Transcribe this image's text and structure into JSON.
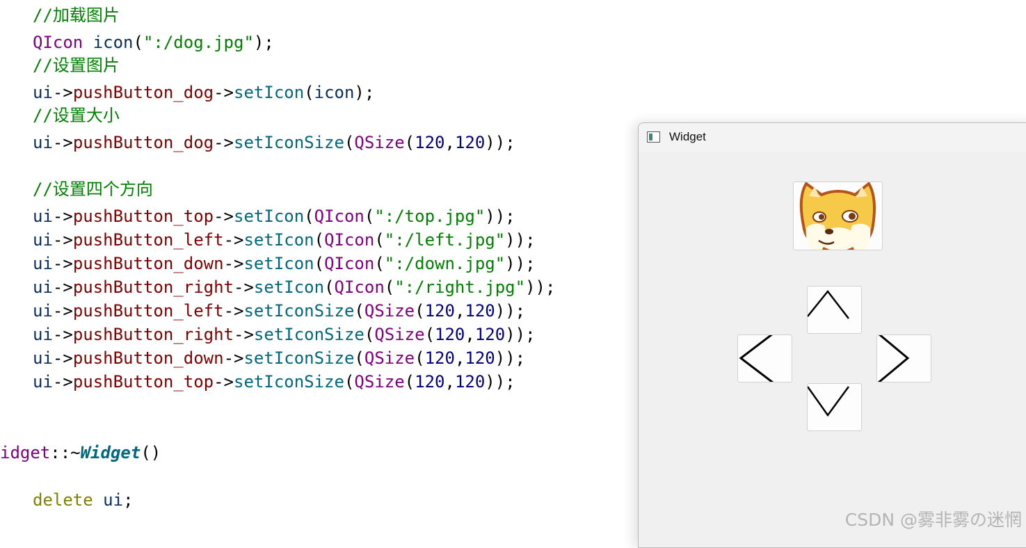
{
  "code_lines": [
    {
      "segments": [
        {
          "cls": "c",
          "text": "//加载图片"
        }
      ]
    },
    {
      "segments": [
        {
          "cls": "t",
          "text": "QIcon"
        },
        {
          "cls": "",
          "text": " "
        },
        {
          "cls": "v",
          "text": "icon"
        },
        {
          "cls": "",
          "text": "("
        },
        {
          "cls": "s",
          "text": "\":/dog.jpg\""
        },
        {
          "cls": "",
          "text": ");"
        }
      ]
    },
    {
      "segments": [
        {
          "cls": "c",
          "text": "//设置图片"
        }
      ]
    },
    {
      "segments": [
        {
          "cls": "v",
          "text": "ui"
        },
        {
          "cls": "",
          "text": "->"
        },
        {
          "cls": "m",
          "text": "pushButton_dog"
        },
        {
          "cls": "",
          "text": "->"
        },
        {
          "cls": "f",
          "text": "setIcon"
        },
        {
          "cls": "",
          "text": "("
        },
        {
          "cls": "v",
          "text": "icon"
        },
        {
          "cls": "",
          "text": ");"
        }
      ]
    },
    {
      "segments": [
        {
          "cls": "c",
          "text": "//设置大小"
        }
      ]
    },
    {
      "segments": [
        {
          "cls": "v",
          "text": "ui"
        },
        {
          "cls": "",
          "text": "->"
        },
        {
          "cls": "m",
          "text": "pushButton_dog"
        },
        {
          "cls": "",
          "text": "->"
        },
        {
          "cls": "f",
          "text": "setIconSize"
        },
        {
          "cls": "",
          "text": "("
        },
        {
          "cls": "t",
          "text": "QSize"
        },
        {
          "cls": "",
          "text": "("
        },
        {
          "cls": "n",
          "text": "120"
        },
        {
          "cls": "",
          "text": ","
        },
        {
          "cls": "n",
          "text": "120"
        },
        {
          "cls": "",
          "text": "));"
        }
      ]
    },
    {
      "segments": [
        {
          "cls": "c",
          "text": "//设置四个方向"
        }
      ]
    },
    {
      "segments": [
        {
          "cls": "v",
          "text": "ui"
        },
        {
          "cls": "",
          "text": "->"
        },
        {
          "cls": "m",
          "text": "pushButton_top"
        },
        {
          "cls": "",
          "text": "->"
        },
        {
          "cls": "f",
          "text": "setIcon"
        },
        {
          "cls": "",
          "text": "("
        },
        {
          "cls": "t",
          "text": "QIcon"
        },
        {
          "cls": "",
          "text": "("
        },
        {
          "cls": "s",
          "text": "\":/top.jpg\""
        },
        {
          "cls": "",
          "text": "));"
        }
      ]
    },
    {
      "segments": [
        {
          "cls": "v",
          "text": "ui"
        },
        {
          "cls": "",
          "text": "->"
        },
        {
          "cls": "m",
          "text": "pushButton_left"
        },
        {
          "cls": "",
          "text": "->"
        },
        {
          "cls": "f",
          "text": "setIcon"
        },
        {
          "cls": "",
          "text": "("
        },
        {
          "cls": "t",
          "text": "QIcon"
        },
        {
          "cls": "",
          "text": "("
        },
        {
          "cls": "s",
          "text": "\":/left.jpg\""
        },
        {
          "cls": "",
          "text": "));"
        }
      ]
    },
    {
      "segments": [
        {
          "cls": "v",
          "text": "ui"
        },
        {
          "cls": "",
          "text": "->"
        },
        {
          "cls": "m",
          "text": "pushButton_down"
        },
        {
          "cls": "",
          "text": "->"
        },
        {
          "cls": "f",
          "text": "setIcon"
        },
        {
          "cls": "",
          "text": "("
        },
        {
          "cls": "t",
          "text": "QIcon"
        },
        {
          "cls": "",
          "text": "("
        },
        {
          "cls": "s",
          "text": "\":/down.jpg\""
        },
        {
          "cls": "",
          "text": "));"
        }
      ]
    },
    {
      "segments": [
        {
          "cls": "v",
          "text": "ui"
        },
        {
          "cls": "",
          "text": "->"
        },
        {
          "cls": "m",
          "text": "pushButton_right"
        },
        {
          "cls": "",
          "text": "->"
        },
        {
          "cls": "f",
          "text": "setIcon"
        },
        {
          "cls": "",
          "text": "("
        },
        {
          "cls": "t",
          "text": "QIcon"
        },
        {
          "cls": "",
          "text": "("
        },
        {
          "cls": "s",
          "text": "\":/right.jpg\""
        },
        {
          "cls": "",
          "text": "));"
        }
      ]
    },
    {
      "segments": [
        {
          "cls": "v",
          "text": "ui"
        },
        {
          "cls": "",
          "text": "->"
        },
        {
          "cls": "m",
          "text": "pushButton_left"
        },
        {
          "cls": "",
          "text": "->"
        },
        {
          "cls": "f",
          "text": "setIconSize"
        },
        {
          "cls": "",
          "text": "("
        },
        {
          "cls": "t",
          "text": "QSize"
        },
        {
          "cls": "",
          "text": "("
        },
        {
          "cls": "n",
          "text": "120"
        },
        {
          "cls": "",
          "text": ","
        },
        {
          "cls": "n",
          "text": "120"
        },
        {
          "cls": "",
          "text": "));"
        }
      ]
    },
    {
      "segments": [
        {
          "cls": "v",
          "text": "ui"
        },
        {
          "cls": "",
          "text": "->"
        },
        {
          "cls": "m",
          "text": "pushButton_right"
        },
        {
          "cls": "",
          "text": "->"
        },
        {
          "cls": "f",
          "text": "setIconSize"
        },
        {
          "cls": "",
          "text": "("
        },
        {
          "cls": "t",
          "text": "QSize"
        },
        {
          "cls": "",
          "text": "("
        },
        {
          "cls": "n",
          "text": "120"
        },
        {
          "cls": "",
          "text": ","
        },
        {
          "cls": "n",
          "text": "120"
        },
        {
          "cls": "",
          "text": "));"
        }
      ]
    },
    {
      "segments": [
        {
          "cls": "v",
          "text": "ui"
        },
        {
          "cls": "",
          "text": "->"
        },
        {
          "cls": "m",
          "text": "pushButton_down"
        },
        {
          "cls": "",
          "text": "->"
        },
        {
          "cls": "f",
          "text": "setIconSize"
        },
        {
          "cls": "",
          "text": "("
        },
        {
          "cls": "t",
          "text": "QSize"
        },
        {
          "cls": "",
          "text": "("
        },
        {
          "cls": "n",
          "text": "120"
        },
        {
          "cls": "",
          "text": ","
        },
        {
          "cls": "n",
          "text": "120"
        },
        {
          "cls": "",
          "text": "));"
        }
      ]
    },
    {
      "segments": [
        {
          "cls": "v",
          "text": "ui"
        },
        {
          "cls": "",
          "text": "->"
        },
        {
          "cls": "m",
          "text": "pushButton_top"
        },
        {
          "cls": "",
          "text": "->"
        },
        {
          "cls": "f",
          "text": "setIconSize"
        },
        {
          "cls": "",
          "text": "("
        },
        {
          "cls": "t",
          "text": "QSize"
        },
        {
          "cls": "",
          "text": "("
        },
        {
          "cls": "n",
          "text": "120"
        },
        {
          "cls": "",
          "text": ","
        },
        {
          "cls": "n",
          "text": "120"
        },
        {
          "cls": "",
          "text": "));"
        }
      ]
    },
    {
      "segments": [
        {
          "cls": "t",
          "text": "idget"
        },
        {
          "cls": "",
          "text": "::~"
        },
        {
          "cls": "fi",
          "text": "Widget"
        },
        {
          "cls": "",
          "text": "()"
        }
      ]
    },
    {
      "segments": [
        {
          "cls": "k",
          "text": "delete"
        },
        {
          "cls": "",
          "text": " "
        },
        {
          "cls": "v",
          "text": "ui"
        },
        {
          "cls": "",
          "text": ";"
        }
      ]
    }
  ],
  "window": {
    "title": "Widget",
    "buttons": [
      {
        "name": "dog-button",
        "icon": "dog-face-icon"
      },
      {
        "name": "top-button",
        "icon": "arrow-up-icon"
      },
      {
        "name": "left-button",
        "icon": "arrow-left-icon"
      },
      {
        "name": "right-button",
        "icon": "arrow-right-icon"
      },
      {
        "name": "down-button",
        "icon": "arrow-down-icon"
      }
    ]
  },
  "watermark": "CSDN @雾非雾の迷惘",
  "colors": {
    "comment": "#008000",
    "type": "#800080",
    "member": "#800000",
    "function": "#00677c",
    "number": "#000080",
    "keyword": "#808000",
    "window_bg": "#f0f0f0",
    "dog_fill": "#f7c948",
    "dog_outline": "#b5541a"
  }
}
